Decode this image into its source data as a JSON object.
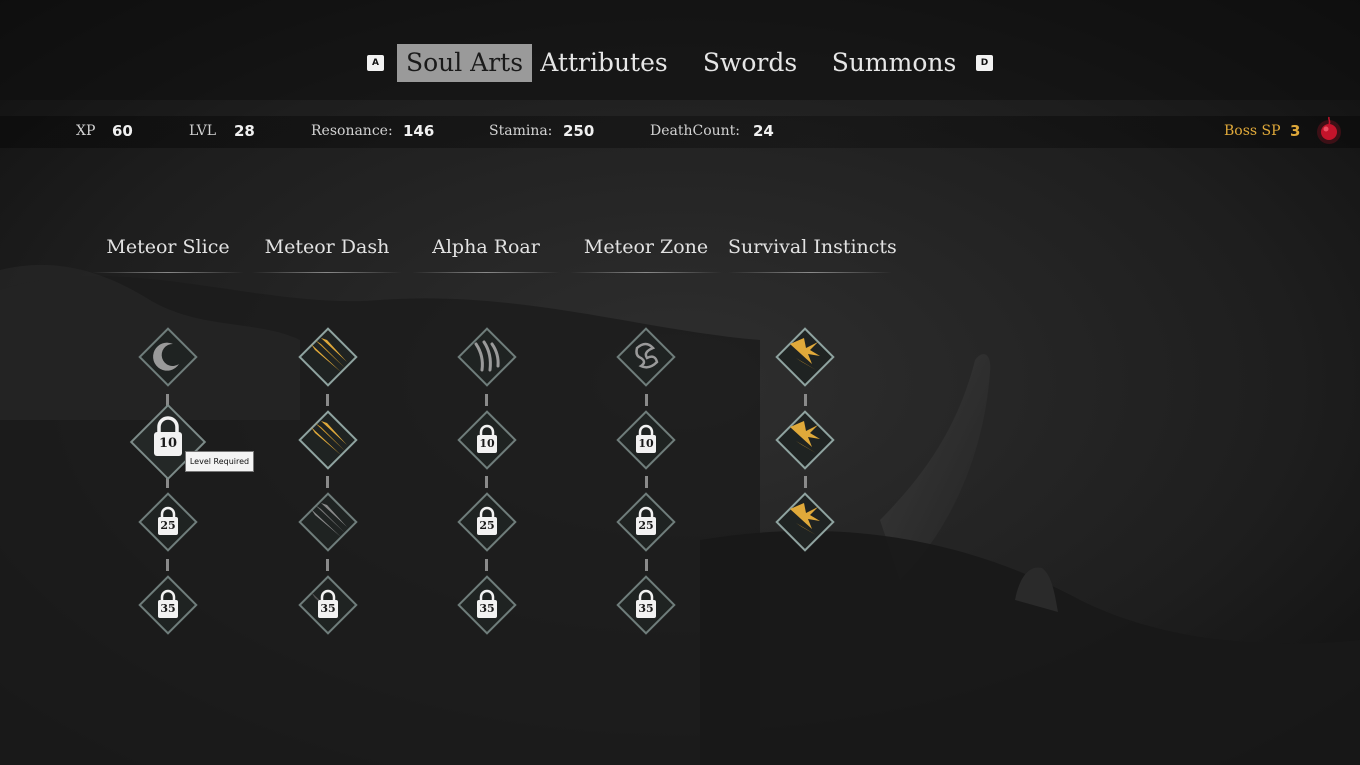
{
  "tabs": {
    "prev_key": "A",
    "next_key": "D",
    "items": [
      {
        "label": "Soul Arts",
        "active": true
      },
      {
        "label": "Attributes",
        "active": false
      },
      {
        "label": "Swords",
        "active": false
      },
      {
        "label": "Summons",
        "active": false
      }
    ]
  },
  "stats": {
    "xp_label": "XP",
    "xp_value": "60",
    "lvl_label": "LVL",
    "lvl_value": "28",
    "resonance_label": "Resonance:",
    "resonance_value": "146",
    "stamina_label": "Stamina:",
    "stamina_value": "250",
    "deathcount_label": "DeathCount:",
    "deathcount_value": "24",
    "boss_sp_label": "Boss SP",
    "boss_sp_value": "3"
  },
  "skills": [
    {
      "name": "Meteor Slice",
      "nodes": [
        {
          "state": "unlocked-grey",
          "icon": "crescent-moon-icon"
        },
        {
          "state": "locked",
          "level": "10"
        },
        {
          "state": "locked",
          "level": "25"
        },
        {
          "state": "locked",
          "level": "35"
        }
      ]
    },
    {
      "name": "Meteor Dash",
      "nodes": [
        {
          "state": "unlocked-gold",
          "icon": "claw-slash-icon"
        },
        {
          "state": "unlocked-gold",
          "icon": "claw-slash-icon"
        },
        {
          "state": "unlocked-grey",
          "icon": "claw-slash-icon"
        },
        {
          "state": "locked",
          "level": "35"
        }
      ]
    },
    {
      "name": "Alpha Roar",
      "nodes": [
        {
          "state": "unlocked-grey",
          "icon": "claw-marks-icon"
        },
        {
          "state": "locked",
          "level": "10"
        },
        {
          "state": "locked",
          "level": "25"
        },
        {
          "state": "locked",
          "level": "35"
        }
      ]
    },
    {
      "name": "Meteor Zone",
      "nodes": [
        {
          "state": "unlocked-grey",
          "icon": "dragon-emblem-icon"
        },
        {
          "state": "locked",
          "level": "10"
        },
        {
          "state": "locked",
          "level": "25"
        },
        {
          "state": "locked",
          "level": "35"
        }
      ]
    },
    {
      "name": "Survival Instincts",
      "nodes": [
        {
          "state": "unlocked-gold",
          "icon": "burst-strike-icon"
        },
        {
          "state": "unlocked-gold",
          "icon": "burst-strike-icon"
        },
        {
          "state": "unlocked-gold",
          "icon": "burst-strike-icon"
        }
      ]
    }
  ],
  "tooltip": {
    "text": "Level Required"
  },
  "colors": {
    "accent_gold": "#e0a93a",
    "boss_orb": "#c4142b",
    "active_tab": "#9a9a9a",
    "node_border": "#8fa3a0"
  }
}
